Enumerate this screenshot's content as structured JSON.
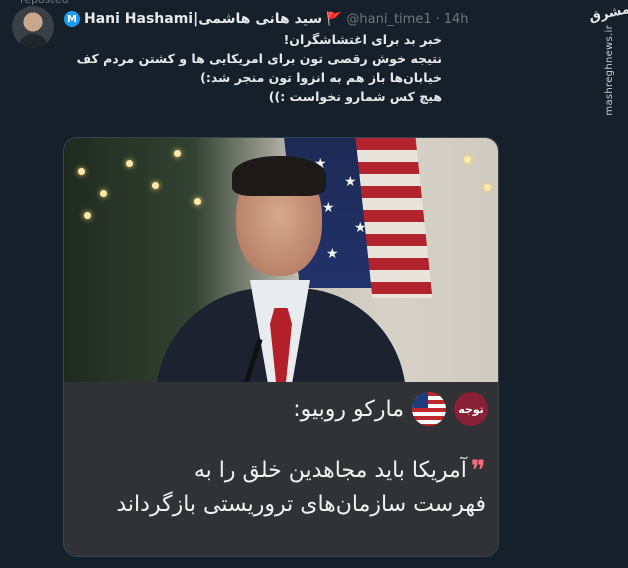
{
  "repost_label": "reposted",
  "author": {
    "verified_badge": "M",
    "name": "Hani Hashami|سید هانی هاشمی",
    "flag": "🚩",
    "handle": "@hani_time1",
    "separator": "·",
    "time": "14h"
  },
  "tweet_lines": [
    "خبر بد برای اغتشاشگران!",
    "نتیجه خوش رقصی تون برای امریکایی ها و کشتن مردم کف خیابان‌ها باز هم به انزوا تون منجر شد:)",
    "هیچ کس شمارو نخواست :))"
  ],
  "watermark": {
    "logo": "مشرق",
    "site": "mashreghnews.ir"
  },
  "card": {
    "tag": "توجه",
    "topic_title": "مارکو روبیو:",
    "quote_line_1": "آمریکا باید مجاهدین خلق را به",
    "quote_line_2": "فهرست سازمان‌های تروریستی بازگرداند"
  },
  "colors": {
    "background": "#15202b",
    "tag_badge": "#8a2036",
    "quote_mark": "#ff6b7f"
  }
}
